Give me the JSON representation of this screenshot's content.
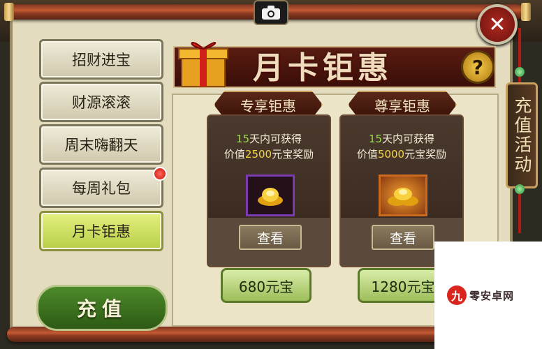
{
  "nav": {
    "items": [
      {
        "label": "招财进宝"
      },
      {
        "label": "财源滚滚"
      },
      {
        "label": "周末嗨翻天"
      },
      {
        "label": "每周礼包"
      },
      {
        "label": "月卡钜惠"
      }
    ],
    "recharge_label": "充值"
  },
  "banner": {
    "title": "月卡钜惠",
    "help": "?"
  },
  "cards": [
    {
      "tab": "专享钜惠",
      "days": "15",
      "desc1_rest": "天内可获得",
      "desc2_pre": "价值",
      "amount": "2500",
      "desc2_rest": "元宝奖励",
      "view_label": "查看",
      "price": "680元宝"
    },
    {
      "tab": "尊享钜惠",
      "days": "15",
      "desc1_rest": "天内可获得",
      "desc2_pre": "价值",
      "amount": "5000",
      "desc2_rest": "元宝奖励",
      "view_label": "查看",
      "price": "1280元宝"
    }
  ],
  "side": {
    "label": "充值活动"
  },
  "close": {
    "glyph": "✕"
  },
  "watermark": {
    "badge": "九",
    "text": "零安卓网"
  },
  "colors": {
    "active_tab": "#c8dc5a",
    "highlight_green": "#9be04a",
    "highlight_gold": "#f2d440",
    "banner": "#4a1810"
  }
}
